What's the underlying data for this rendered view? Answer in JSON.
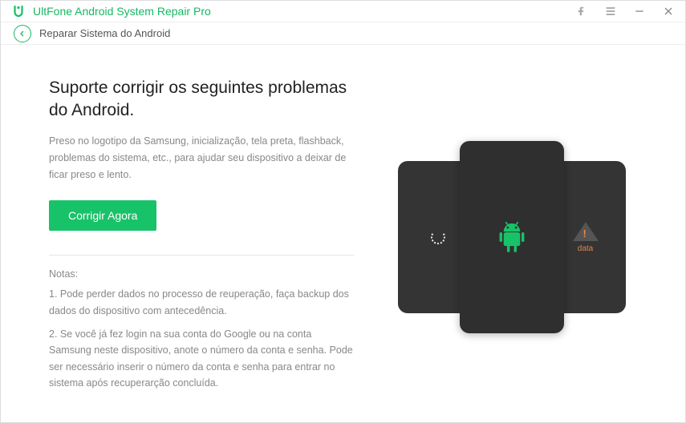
{
  "app": {
    "title": "UltFone Android System Repair Pro"
  },
  "subheader": {
    "title": "Reparar Sistema do Android"
  },
  "main": {
    "headline": "Suporte corrigir os seguintes problemas do Android.",
    "description": "Preso no logotipo da Samsung, inicialização, tela preta, flashback, problemas do sistema, etc., para ajudar seu dispositivo a deixar de ficar preso e lento.",
    "cta_label": "Corrigir Agora"
  },
  "notes": {
    "label": "Notas:",
    "items": [
      "1. Pode perder dados no processo de reuperação, faça backup dos dados do dispositivo com antecedência.",
      "2. Se você já fez login na sua conta do Google ou na conta Samsung neste dispositivo, anote o número da conta e senha. Pode ser necessário inserir o número da conta e senha para entrar no sistema após recuperarção concluída."
    ]
  },
  "right_phone_caption": "data"
}
